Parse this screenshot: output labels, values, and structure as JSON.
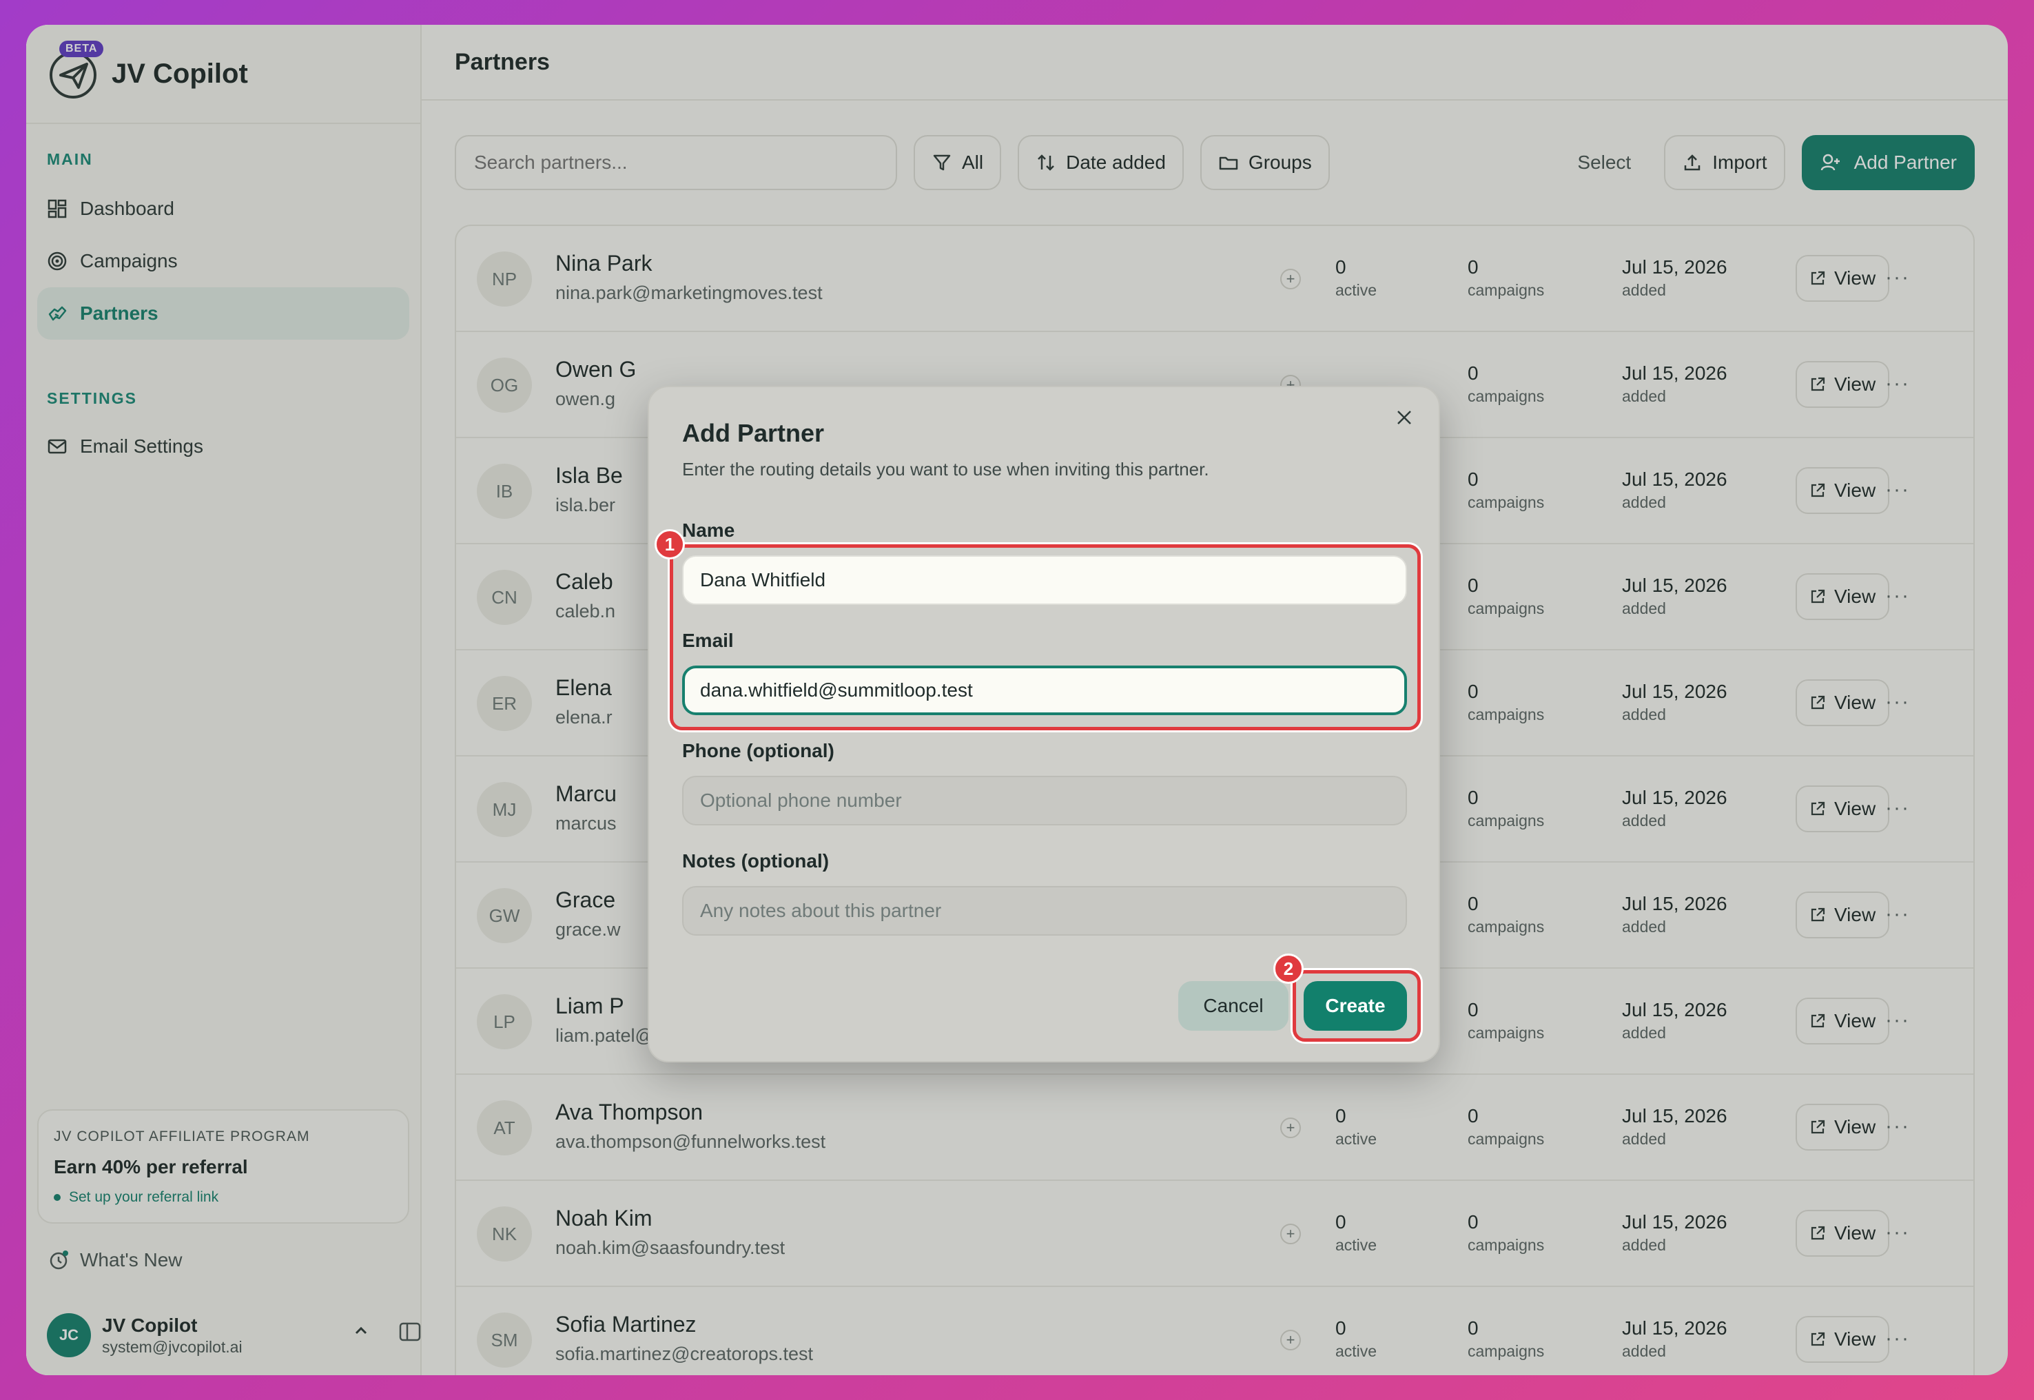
{
  "app": {
    "name": "JV Copilot",
    "badge": "BETA"
  },
  "sidebar": {
    "main_label": "MAIN",
    "main_items": [
      {
        "label": "Dashboard",
        "icon": "dashboard-icon"
      },
      {
        "label": "Campaigns",
        "icon": "target-icon"
      },
      {
        "label": "Partners",
        "icon": "handshake-icon",
        "active": true
      }
    ],
    "settings_label": "SETTINGS",
    "settings_items": [
      {
        "label": "Email Settings",
        "icon": "mail-icon"
      }
    ],
    "affiliate": {
      "label": "JV COPILOT AFFILIATE PROGRAM",
      "title": "Earn 40% per referral",
      "link": "Set up your referral link"
    },
    "whats_new": "What's New",
    "user": {
      "initials": "JC",
      "name": "JV Copilot",
      "email": "system@jvcopilot.ai"
    }
  },
  "header": {
    "title": "Partners"
  },
  "toolbar": {
    "search_placeholder": "Search partners...",
    "filter_label": "All",
    "sort_label": "Date added",
    "groups_label": "Groups",
    "select_label": "Select",
    "import_label": "Import",
    "add_label": "Add Partner"
  },
  "partners": {
    "active_label": "active",
    "campaigns_label": "campaigns",
    "added_label": "added",
    "view_label": "View",
    "rows": [
      {
        "initials": "NP",
        "name": "Nina Park",
        "email": "nina.park@marketingmoves.test",
        "active": "0",
        "campaigns": "0",
        "date": "Jul 15, 2026"
      },
      {
        "initials": "OG",
        "name": "Owen G",
        "email": "owen.g",
        "active": "",
        "campaigns": "0",
        "date": "Jul 15, 2026"
      },
      {
        "initials": "IB",
        "name": "Isla Be",
        "email": "isla.ber",
        "active": "",
        "campaigns": "0",
        "date": "Jul 15, 2026"
      },
      {
        "initials": "CN",
        "name": "Caleb",
        "email": "caleb.n",
        "active": "",
        "campaigns": "0",
        "date": "Jul 15, 2026"
      },
      {
        "initials": "ER",
        "name": "Elena",
        "email": "elena.r",
        "active": "",
        "campaigns": "0",
        "date": "Jul 15, 2026"
      },
      {
        "initials": "MJ",
        "name": "Marcu",
        "email": "marcus",
        "active": "",
        "campaigns": "0",
        "date": "Jul 15, 2026"
      },
      {
        "initials": "GW",
        "name": "Grace",
        "email": "grace.w",
        "active": "",
        "campaigns": "0",
        "date": "Jul 15, 2026"
      },
      {
        "initials": "LP",
        "name": "Liam P",
        "email": "liam.patel@operatorletter.test",
        "active": "",
        "campaigns": "0",
        "date": "Jul 15, 2026"
      },
      {
        "initials": "AT",
        "name": "Ava Thompson",
        "email": "ava.thompson@funnelworks.test",
        "active": "0",
        "campaigns": "0",
        "date": "Jul 15, 2026"
      },
      {
        "initials": "NK",
        "name": "Noah Kim",
        "email": "noah.kim@saasfoundry.test",
        "active": "0",
        "campaigns": "0",
        "date": "Jul 15, 2026"
      },
      {
        "initials": "SM",
        "name": "Sofia Martinez",
        "email": "sofia.martinez@creatorops.test",
        "active": "0",
        "campaigns": "0",
        "date": "Jul 15, 2026"
      }
    ]
  },
  "modal": {
    "title": "Add Partner",
    "description": "Enter the routing details you want to use when inviting this partner.",
    "name_label": "Name",
    "name_value": "Dana Whitfield",
    "email_label": "Email",
    "email_value": "dana.whitfield@summitloop.test",
    "phone_label": "Phone (optional)",
    "phone_placeholder": "Optional phone number",
    "notes_label": "Notes (optional)",
    "notes_placeholder": "Any notes about this partner",
    "cancel_label": "Cancel",
    "create_label": "Create",
    "step1": "1",
    "step2": "2"
  },
  "colors": {
    "accent": "#17806e",
    "highlight": "#e03a3e",
    "beta": "#5f3dc4"
  }
}
